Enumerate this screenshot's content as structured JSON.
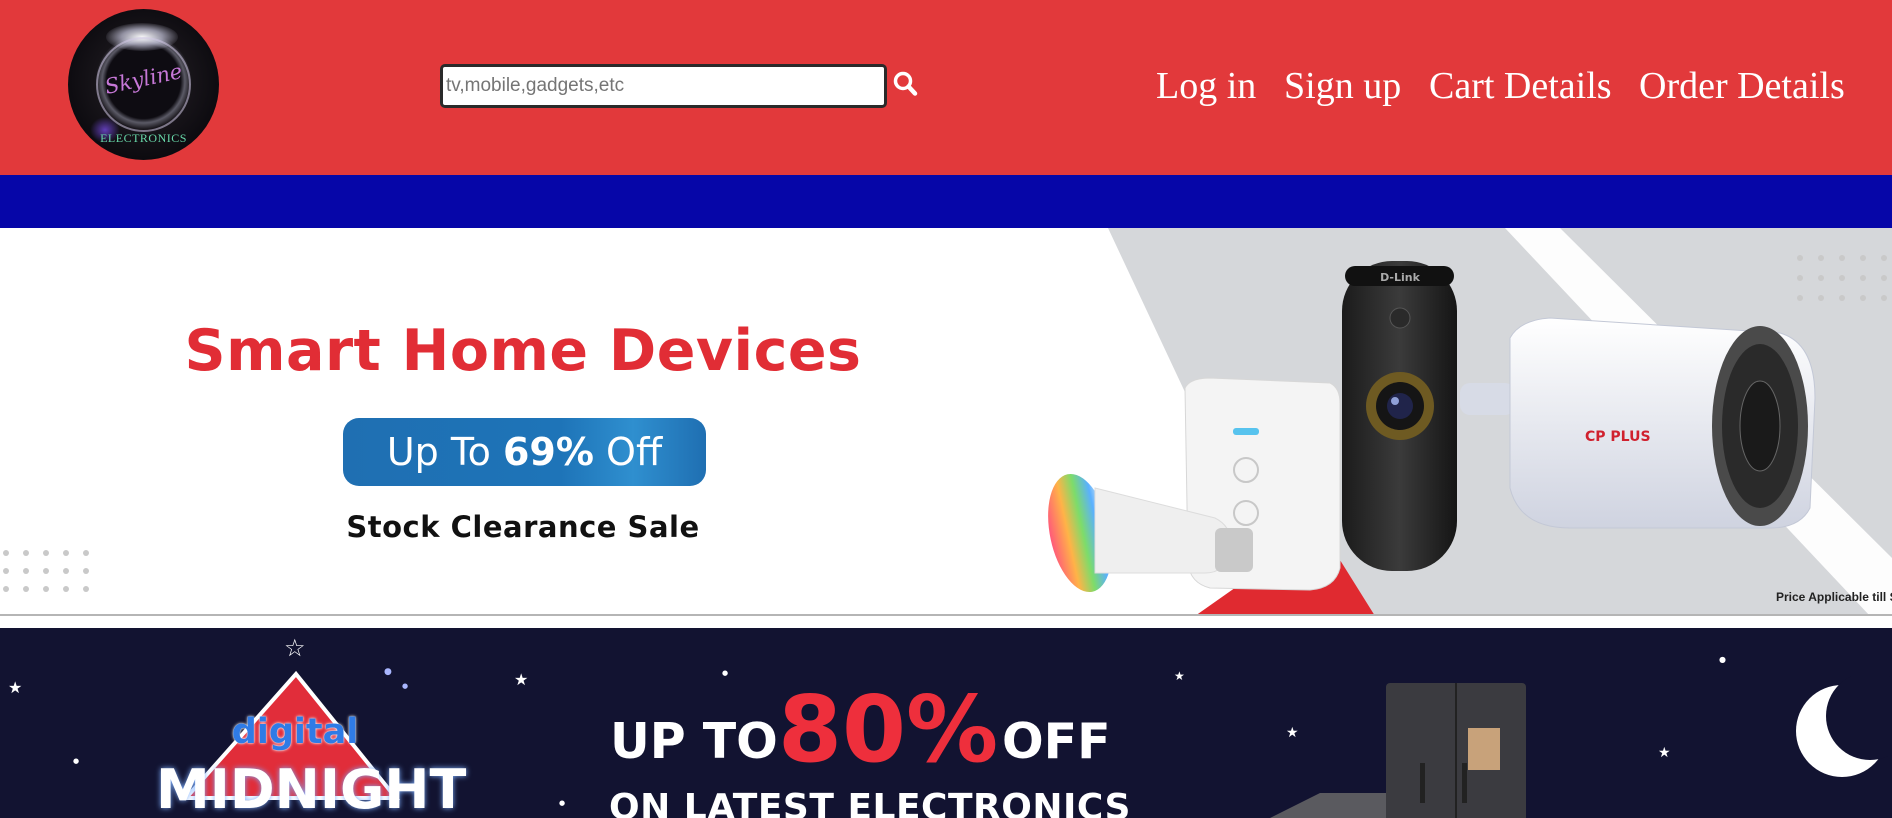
{
  "header": {
    "logo": {
      "script_text": "Skyline",
      "sub_text": "ELECTRONICS"
    },
    "search": {
      "placeholder": "tv,mobile,gadgets,etc",
      "value": "",
      "button_icon": "search-icon"
    },
    "nav": [
      {
        "label": "Log in"
      },
      {
        "label": "Sign up"
      },
      {
        "label": "Cart Details"
      },
      {
        "label": "Order Details"
      }
    ],
    "colors": {
      "header_bg": "#e2393b",
      "strip_bg": "#0606a8"
    }
  },
  "banners": {
    "smart_home": {
      "title": "Smart Home Devices",
      "pill_prefix": "Up To",
      "pill_percent": "69%",
      "pill_suffix": "Off",
      "subtitle": "Stock Clearance Sale",
      "fine_print": "Price Applicable till S",
      "camera_brand": "CP PLUS",
      "cam_brand_top": "D-Link"
    },
    "digital_midnight": {
      "badge_top": "digital",
      "badge_bottom": "MIDNIGHT",
      "upto": "UP TO",
      "percent": "80%",
      "off": "OFF",
      "tagline": "ON LATEST ELECTRONICS"
    }
  }
}
